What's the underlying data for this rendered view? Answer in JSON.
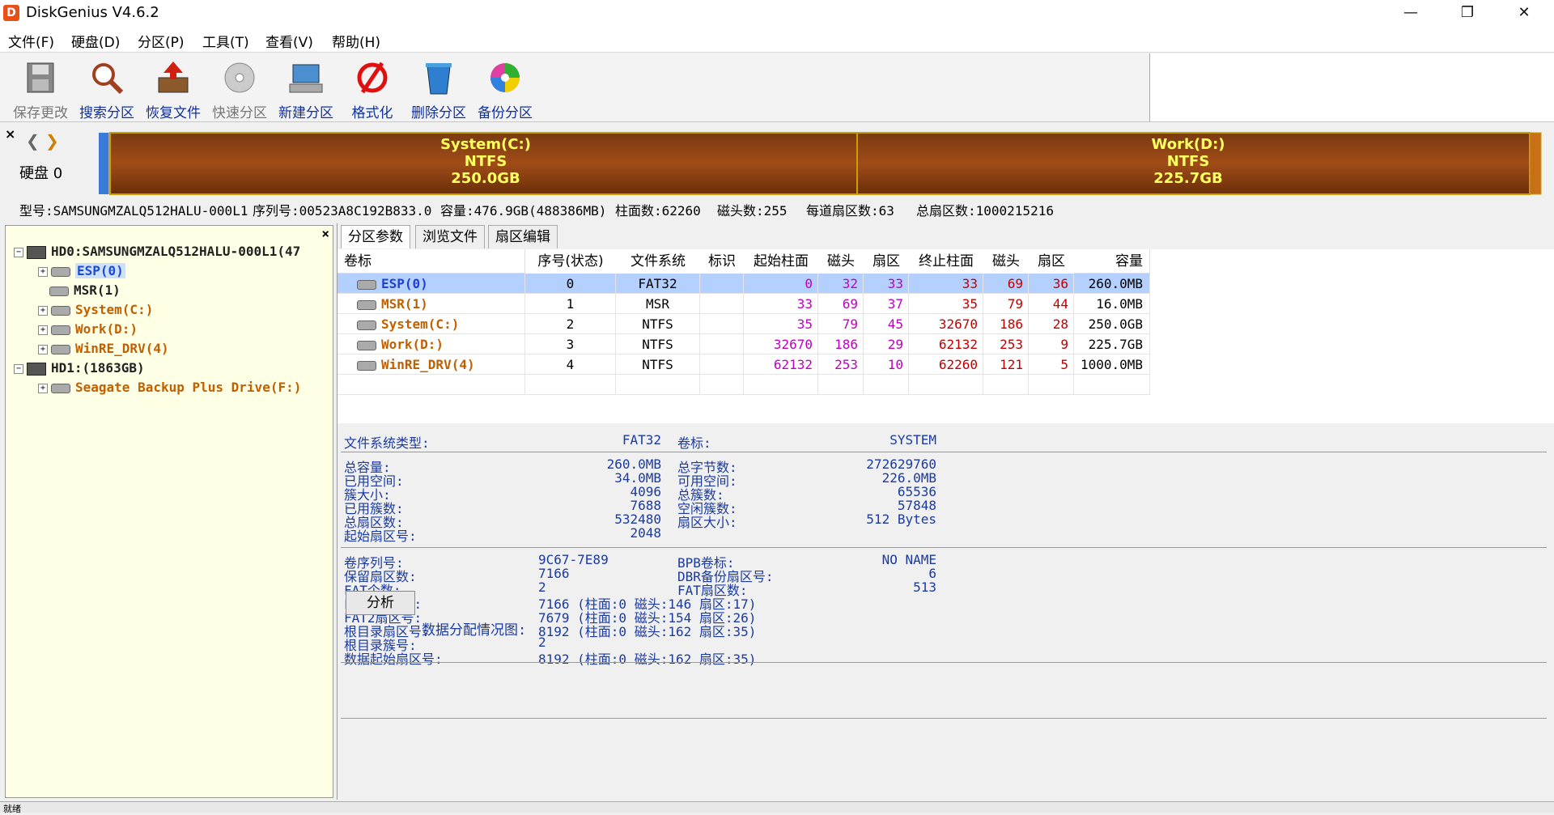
{
  "window": {
    "title": "DiskGenius V4.6.2",
    "minimize": "—",
    "restore": "❐",
    "close": "✕",
    "app_icon": "D"
  },
  "menu": [
    "文件(F)",
    "硬盘(D)",
    "分区(P)",
    "工具(T)",
    "查看(V)",
    "帮助(H)"
  ],
  "toolbar": [
    {
      "label": "保存更改",
      "icon": "save-disk-icon",
      "enabled": false
    },
    {
      "label": "搜索分区",
      "icon": "magnifier-icon",
      "enabled": true
    },
    {
      "label": "恢复文件",
      "icon": "recover-files-icon",
      "enabled": true
    },
    {
      "label": "快速分区",
      "icon": "quick-partition-icon",
      "enabled": false
    },
    {
      "label": "新建分区",
      "icon": "new-partition-icon",
      "enabled": true
    },
    {
      "label": "格式化",
      "icon": "format-icon",
      "enabled": true
    },
    {
      "label": "删除分区",
      "icon": "delete-partition-icon",
      "enabled": true
    },
    {
      "label": "备份分区",
      "icon": "backup-partition-icon",
      "enabled": true
    }
  ],
  "diskbar": {
    "close": "×",
    "disk_label": "硬盘 0",
    "partitions": [
      {
        "name": "System(C:)",
        "fs": "NTFS",
        "size": "250.0GB"
      },
      {
        "name": "Work(D:)",
        "fs": "NTFS",
        "size": "225.7GB"
      }
    ]
  },
  "disk_info": {
    "model": "型号:SAMSUNGMZALQ512HALU-000L1",
    "serial": "序列号:00523A8C192B833.0",
    "capacity": "容量:476.9GB(488386MB)",
    "cylinders": "柱面数:62260",
    "heads": "磁头数:255",
    "sectors_per_track": "每道扇区数:63",
    "total_sectors": "总扇区数:1000215216"
  },
  "tree": {
    "close": "×",
    "items": [
      {
        "label": "HD0:SAMSUNGMZALQ512HALU-000L1(47",
        "kind": "disk"
      },
      {
        "label": "ESP(0)",
        "kind": "part",
        "style": "selected"
      },
      {
        "label": "MSR(1)",
        "kind": "part",
        "style": "dark"
      },
      {
        "label": "System(C:)",
        "kind": "part",
        "style": "orange"
      },
      {
        "label": "Work(D:)",
        "kind": "part",
        "style": "orange"
      },
      {
        "label": "WinRE_DRV(4)",
        "kind": "part",
        "style": "orange"
      },
      {
        "label": "HD1:(1863GB)",
        "kind": "disk"
      },
      {
        "label": "Seagate Backup Plus Drive(F:)",
        "kind": "part",
        "style": "orange"
      }
    ]
  },
  "tabs": [
    "分区参数",
    "浏览文件",
    "扇区编辑"
  ],
  "table": {
    "headers": [
      "卷标",
      "序号(状态)",
      "文件系统",
      "标识",
      "起始柱面",
      "磁头",
      "扇区",
      "终止柱面",
      "磁头",
      "扇区",
      "容量"
    ],
    "rows": [
      [
        "ESP(0)",
        "0",
        "FAT32",
        "",
        "0",
        "32",
        "33",
        "33",
        "69",
        "36",
        "260.0MB"
      ],
      [
        "MSR(1)",
        "1",
        "MSR",
        "",
        "33",
        "69",
        "37",
        "35",
        "79",
        "44",
        "16.0MB"
      ],
      [
        "System(C:)",
        "2",
        "NTFS",
        "",
        "35",
        "79",
        "45",
        "32670",
        "186",
        "28",
        "250.0GB"
      ],
      [
        "Work(D:)",
        "3",
        "NTFS",
        "",
        "32670",
        "186",
        "29",
        "62132",
        "253",
        "9",
        "225.7GB"
      ],
      [
        "WinRE_DRV(4)",
        "4",
        "NTFS",
        "",
        "62132",
        "253",
        "10",
        "62260",
        "121",
        "5",
        "1000.0MB"
      ]
    ]
  },
  "details": {
    "fs_type_label": "文件系统类型:",
    "fs_type": "FAT32",
    "vol_label_label": "卷标:",
    "vol_label": "SYSTEM",
    "left1": [
      [
        "总容量:",
        "260.0MB"
      ],
      [
        "已用空间:",
        "34.0MB"
      ],
      [
        "簇大小:",
        "4096"
      ],
      [
        "已用簇数:",
        "7688"
      ],
      [
        "总扇区数:",
        "532480"
      ],
      [
        "起始扇区号:",
        "2048"
      ]
    ],
    "right1": [
      [
        "总字节数:",
        "272629760"
      ],
      [
        "可用空间:",
        "226.0MB"
      ],
      [
        "总簇数:",
        "65536"
      ],
      [
        "空闲簇数:",
        "57848"
      ],
      [
        "扇区大小:",
        "512 Bytes"
      ]
    ],
    "left2": [
      [
        "卷序列号:",
        "9C67-7E89"
      ],
      [
        "保留扇区数:",
        "7166"
      ],
      [
        "FAT个数:",
        "2"
      ],
      [
        "FAT1扇区号:",
        "7166 (柱面:0 磁头:146 扇区:17)"
      ],
      [
        "FAT2扇区号:",
        "7679 (柱面:0 磁头:154 扇区:26)"
      ],
      [
        "根目录扇区号:",
        "8192 (柱面:0 磁头:162 扇区:35)"
      ],
      [
        "根目录簇号:",
        "2"
      ],
      [
        "数据起始扇区号:",
        "8192 (柱面:0 磁头:162 扇区:35)"
      ]
    ],
    "right2": [
      [
        "BPB卷标:",
        "NO NAME"
      ],
      [
        "DBR备份扇区号:",
        "6"
      ],
      [
        "FAT扇区数:",
        "513"
      ]
    ],
    "analyze_button": "分析",
    "alloc_label": "数据分配情况图:"
  },
  "status": "就绪"
}
